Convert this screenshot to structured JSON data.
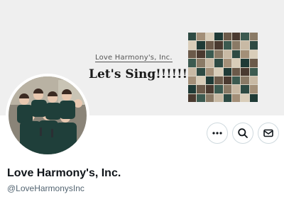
{
  "banner": {
    "brand_text": "Love Harmony's, Inc.",
    "slogan": "Let's Sing!!!!!!!+",
    "background_color": "#efefef"
  },
  "profile": {
    "display_name": "Love Harmony's, Inc.",
    "handle": "@LoveHarmonysInc"
  },
  "actions": [
    {
      "name": "more-options",
      "icon": "more-horizontal-icon"
    },
    {
      "name": "search",
      "icon": "search-icon"
    },
    {
      "name": "message",
      "icon": "envelope-icon"
    }
  ],
  "colors": {
    "text_primary": "#0f1419",
    "text_secondary": "#536471",
    "button_border": "#cfd9de"
  }
}
